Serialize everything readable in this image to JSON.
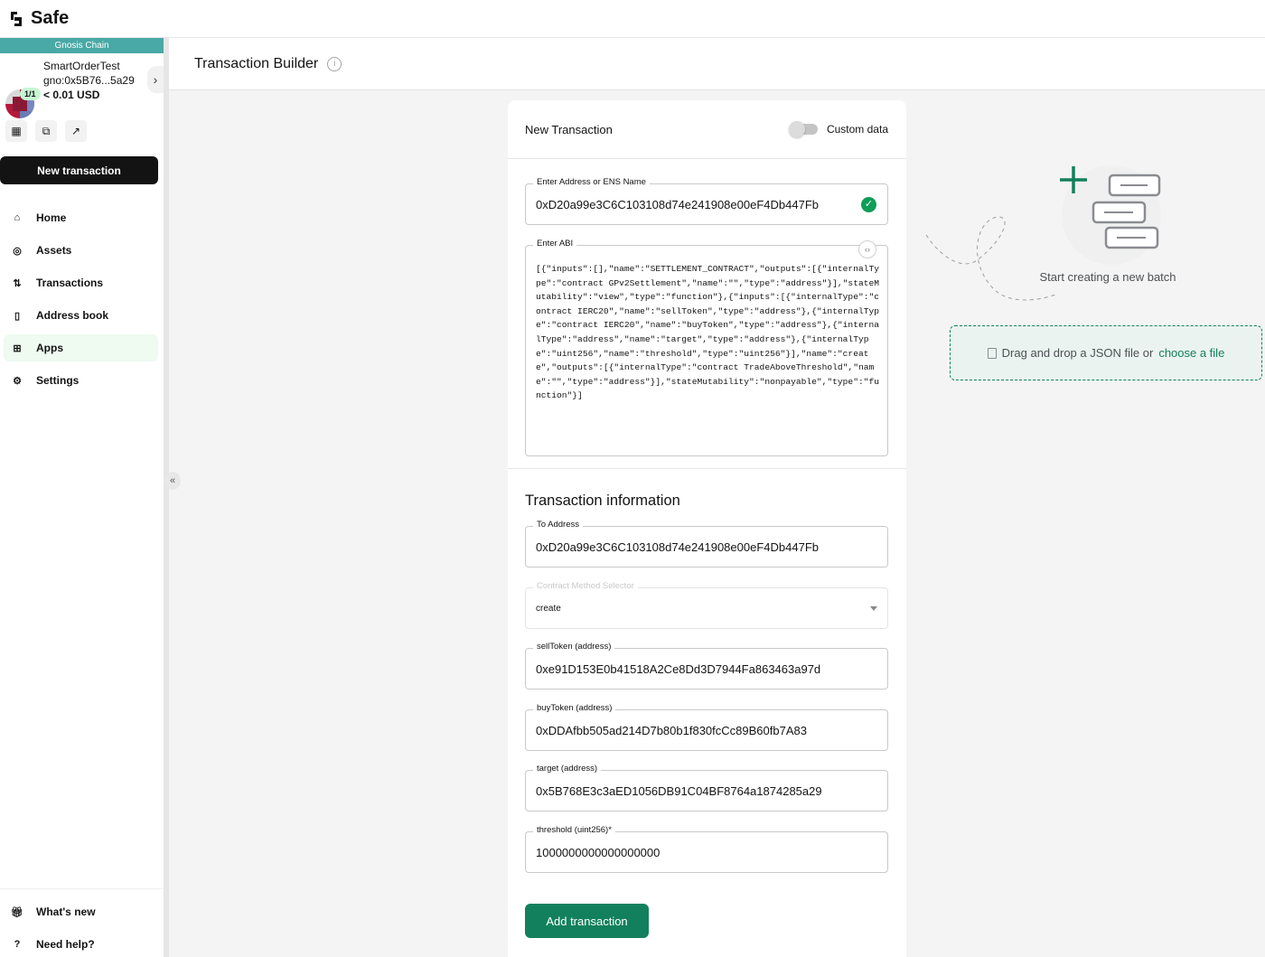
{
  "app": {
    "logo_text": "Safe"
  },
  "sidebar": {
    "chain_name": "Gnosis Chain",
    "safe_name": "SmartOrderTest",
    "safe_address": "gno:0x5B76...5a29",
    "balance": "< 0.01 USD",
    "threshold": "1/1",
    "new_transaction_label": "New transaction",
    "nav_items": [
      {
        "label": "Home",
        "icon": "home-icon"
      },
      {
        "label": "Assets",
        "icon": "assets-icon"
      },
      {
        "label": "Transactions",
        "icon": "transactions-icon"
      },
      {
        "label": "Address book",
        "icon": "address-book-icon"
      },
      {
        "label": "Apps",
        "icon": "apps-icon",
        "active": true
      },
      {
        "label": "Settings",
        "icon": "settings-icon"
      }
    ],
    "bottom_items": [
      {
        "label": "What's new",
        "icon": "gift-icon"
      },
      {
        "label": "Need help?",
        "icon": "help-icon"
      }
    ]
  },
  "page": {
    "title": "Transaction Builder"
  },
  "card": {
    "title": "New Transaction",
    "custom_data_label": "Custom data",
    "address_field": {
      "label": "Enter Address or ENS Name",
      "value": "0xD20a99e3C6C103108d74e241908e00eF4Db447Fb"
    },
    "abi_field": {
      "label": "Enter ABI",
      "value": "[{\"inputs\":[],\"name\":\"SETTLEMENT_CONTRACT\",\"outputs\":[{\"internalType\":\"contract GPv2Settlement\",\"name\":\"\",\"type\":\"address\"}],\"stateMutability\":\"view\",\"type\":\"function\"},{\"inputs\":[{\"internalType\":\"contract IERC20\",\"name\":\"sellToken\",\"type\":\"address\"},{\"internalType\":\"contract IERC20\",\"name\":\"buyToken\",\"type\":\"address\"},{\"internalType\":\"address\",\"name\":\"target\",\"type\":\"address\"},{\"internalType\":\"uint256\",\"name\":\"threshold\",\"type\":\"uint256\"}],\"name\":\"create\",\"outputs\":[{\"internalType\":\"contract TradeAboveThreshold\",\"name\":\"\",\"type\":\"address\"}],\"stateMutability\":\"nonpayable\",\"type\":\"function\"}]"
    },
    "section_title": "Transaction information",
    "to_address": {
      "label": "To Address",
      "value": "0xD20a99e3C6C103108d74e241908e00eF4Db447Fb"
    },
    "method_selector": {
      "label": "Contract Method Selector",
      "value": "create"
    },
    "sell_token": {
      "label": "sellToken (address)",
      "value": "0xe91D153E0b41518A2Ce8Dd3D7944Fa863463a97d"
    },
    "buy_token": {
      "label": "buyToken (address)",
      "value": "0xDDAfbb505ad214D7b80b1f830fcCc89B60fb7A83"
    },
    "target": {
      "label": "target (address)",
      "value": "0x5B768E3c3aED1056DB91C04BF8764a1874285a29"
    },
    "threshold": {
      "label": "threshold (uint256)*",
      "value": "1000000000000000000"
    },
    "add_button_label": "Add transaction"
  },
  "batch": {
    "caption": "Start creating a new batch",
    "dropzone_text": "Drag and drop a JSON file or",
    "dropzone_link": "choose a file"
  },
  "colors": {
    "accent": "#12805c",
    "chain": "#48a9a6",
    "success": "#0f9d58"
  }
}
